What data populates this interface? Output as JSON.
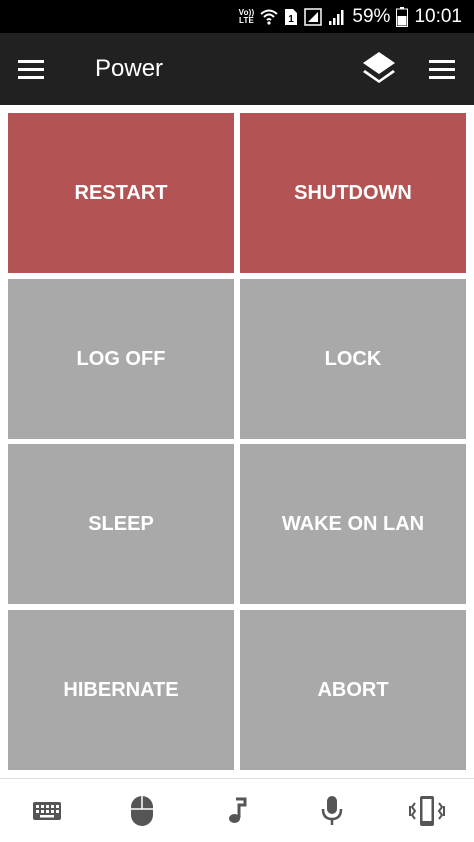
{
  "status_bar": {
    "network_label": "Vo)) LTE",
    "sim_slot": "1",
    "battery_percent": "59%",
    "time": "10:01",
    "icons": [
      "volte-icon",
      "wifi-icon",
      "sim-icon",
      "signal-icon",
      "signal-icon",
      "battery-icon"
    ]
  },
  "app_bar": {
    "title": "Power",
    "icons": [
      "hamburger-menu-icon",
      "layers-icon",
      "overflow-menu-icon"
    ]
  },
  "tiles": [
    {
      "label": "RESTART",
      "style": "danger"
    },
    {
      "label": "SHUTDOWN",
      "style": "danger"
    },
    {
      "label": "LOG OFF",
      "style": "normal"
    },
    {
      "label": "LOCK",
      "style": "normal"
    },
    {
      "label": "SLEEP",
      "style": "normal"
    },
    {
      "label": "WAKE ON LAN",
      "style": "normal"
    },
    {
      "label": "HIBERNATE",
      "style": "normal"
    },
    {
      "label": "ABORT",
      "style": "normal"
    }
  ],
  "bottom_nav": [
    "keyboard-icon",
    "mouse-icon",
    "music-note-icon",
    "microphone-icon",
    "phone-vibrate-icon"
  ],
  "colors": {
    "danger": "#b35353",
    "normal": "#a9a9a9",
    "app_bar": "#212121",
    "status_bar": "#000000",
    "bottom_icon": "#555555"
  }
}
